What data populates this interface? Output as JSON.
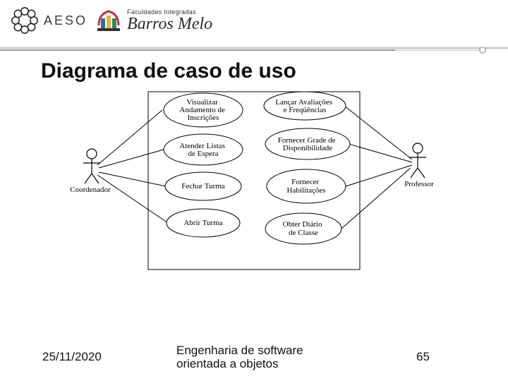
{
  "header": {
    "aeso_text": "AESO",
    "bm_small": "Faculdades Integradas",
    "bm_big": "Barros Melo"
  },
  "title": "Diagrama de caso de uso",
  "diagram": {
    "actors": {
      "left": "Coordenador",
      "right": "Professor"
    },
    "usecases_left": [
      [
        "Visualizar",
        "Andamento de",
        "Inscrições"
      ],
      [
        "Atender Listas",
        "de Espera"
      ],
      [
        "Fechar Turma"
      ],
      [
        "Abrir Turma"
      ]
    ],
    "usecases_right": [
      [
        "Lançar Avaliações",
        "e Freqüências"
      ],
      [
        "Fornecer Grade de",
        "Disponibilidade"
      ],
      [
        "Fornecer",
        "Habilitações"
      ],
      [
        "Obter Diário",
        "de Classe"
      ]
    ]
  },
  "footer": {
    "date": "25/11/2020",
    "center_l1": "Engenharia de software",
    "center_l2": "orientada a objetos",
    "page": "65"
  }
}
